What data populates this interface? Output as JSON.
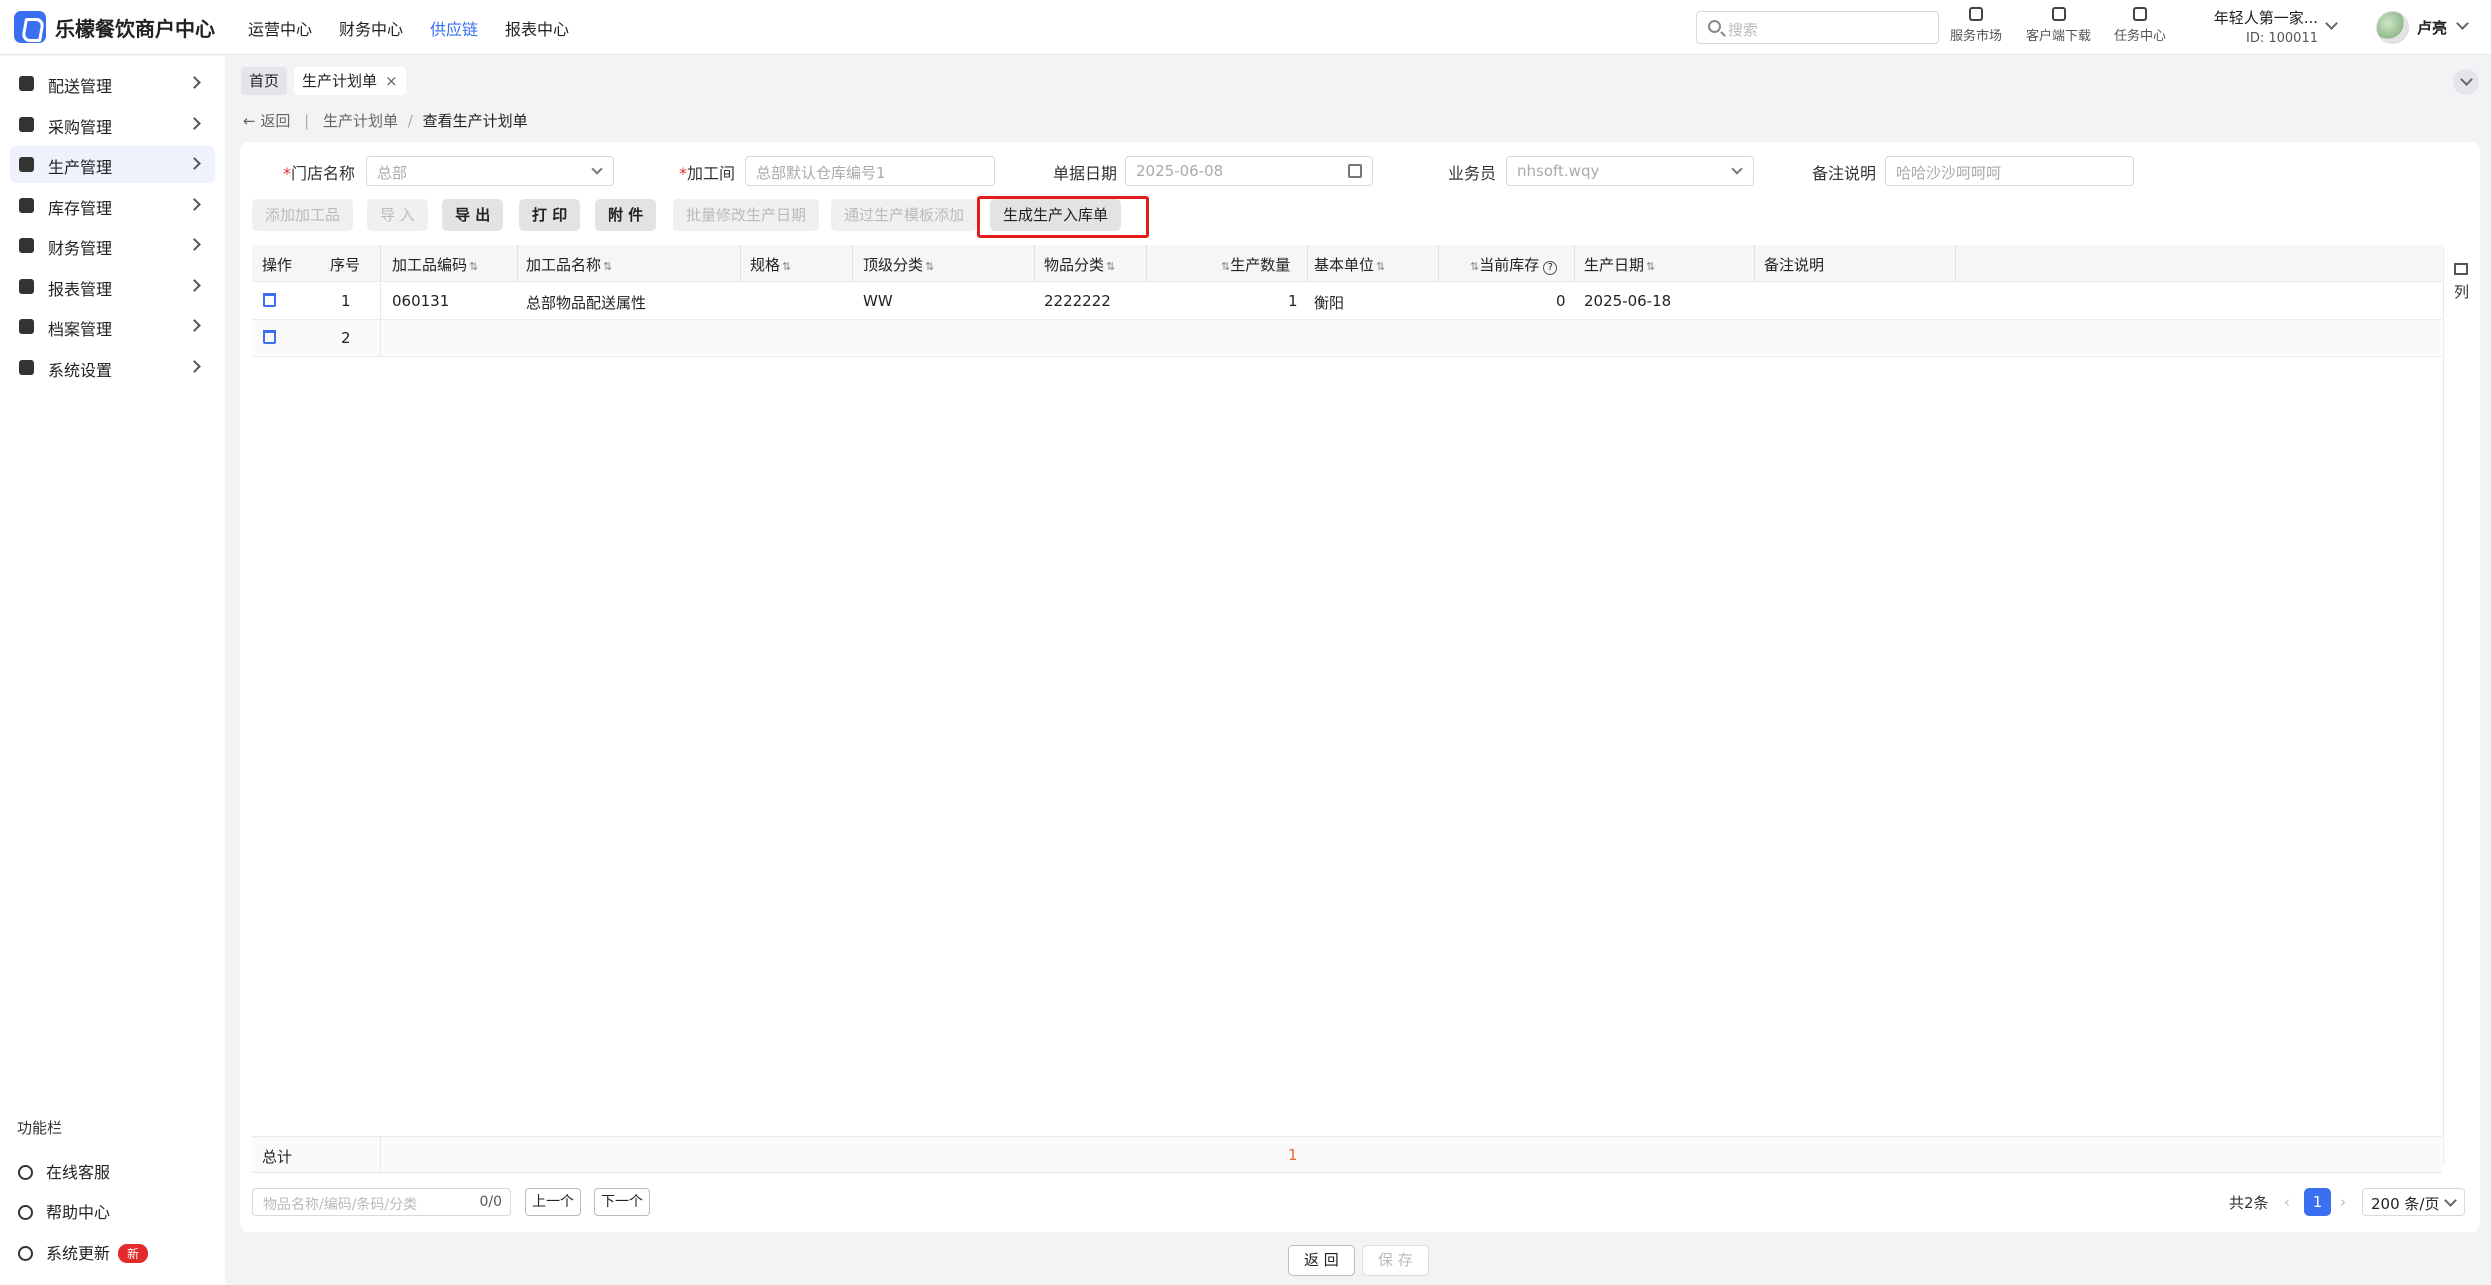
{
  "app": {
    "title": "乐檬餐饮商户中心"
  },
  "topnav": [
    "运营中心",
    "财务中心",
    "供应链",
    "报表中心"
  ],
  "search": {
    "placeholder": "搜索"
  },
  "tools": [
    "服务市场",
    "客户端下载",
    "任务中心"
  ],
  "org": {
    "name": "年轻人第一家...",
    "id": "ID: 100011"
  },
  "user": {
    "name": "卢亮"
  },
  "sidebar": {
    "items": [
      {
        "label": "配送管理",
        "icon": "truck-icon"
      },
      {
        "label": "采购管理",
        "icon": "cart-icon"
      },
      {
        "label": "生产管理",
        "icon": "production-icon",
        "active": true
      },
      {
        "label": "库存管理",
        "icon": "warehouse-icon"
      },
      {
        "label": "财务管理",
        "icon": "wallet-icon"
      },
      {
        "label": "报表管理",
        "icon": "report-icon"
      },
      {
        "label": "档案管理",
        "icon": "archive-icon"
      },
      {
        "label": "系统设置",
        "icon": "gear-icon"
      }
    ],
    "function_title": "功能栏",
    "function_items": [
      {
        "label": "在线客服",
        "icon": "headset-icon"
      },
      {
        "label": "帮助中心",
        "icon": "help-icon"
      },
      {
        "label": "系统更新",
        "icon": "refresh-icon",
        "badge": "新"
      }
    ]
  },
  "tabs": {
    "home": "首页",
    "current": "生产计划单",
    "close": "×"
  },
  "breadcrumb": {
    "back": "返回",
    "parent": "生产计划单",
    "separator": "/",
    "current": "查看生产计划单"
  },
  "form": {
    "store": {
      "label": "门店名称",
      "value": "总部"
    },
    "workshop": {
      "label": "加工间",
      "placeholder": "总部默认仓库编号1"
    },
    "date": {
      "label": "单据日期",
      "value": "2025-06-08"
    },
    "salesman": {
      "label": "业务员",
      "value": "nhsoft.wqy"
    },
    "remark": {
      "label": "备注说明",
      "value": "哈哈沙沙呵呵呵"
    },
    "required_mark": "*"
  },
  "actions": {
    "add_item": "添加加工品",
    "import": "导 入",
    "export": "导 出",
    "print": "打 印",
    "attach": "附 件",
    "batch_date": "批量修改生产日期",
    "template_add": "通过生产模板添加",
    "generate": "生成生产入库单"
  },
  "table": {
    "headers": [
      "操作",
      "序号",
      "加工品编码",
      "加工品名称",
      "规格",
      "顶级分类",
      "物品分类",
      "生产数量",
      "基本单位",
      "当前库存",
      "生产日期",
      "备注说明"
    ],
    "rows": [
      {
        "seq": "1",
        "code": "060131",
        "name": "总部物品配送属性",
        "spec": "",
        "top_cat": "WW",
        "cat": "2222222",
        "qty": "1",
        "unit": "衡阳",
        "stock": "0",
        "prod_date": "2025-06-18",
        "remark": ""
      },
      {
        "seq": "2",
        "code": "",
        "name": "",
        "spec": "",
        "top_cat": "",
        "cat": "",
        "qty": "",
        "unit": "",
        "stock": "",
        "prod_date": "",
        "remark": ""
      }
    ],
    "total_label": "总计",
    "total_qty": "1",
    "column_setting": "列"
  },
  "bottom": {
    "search_placeholder": "物品名称/编码/条码/分类",
    "match_count": "0/0",
    "prev": "上一个",
    "next": "下一个",
    "total": "共2条",
    "page": "1",
    "page_size": "200 条/页"
  },
  "footer": {
    "back": "返 回",
    "save": "保 存"
  },
  "colors": {
    "accent": "#3a6ff2",
    "highlight": "#e21c1c",
    "badge": "#e32b2b",
    "total_qty": "#e8683a"
  }
}
